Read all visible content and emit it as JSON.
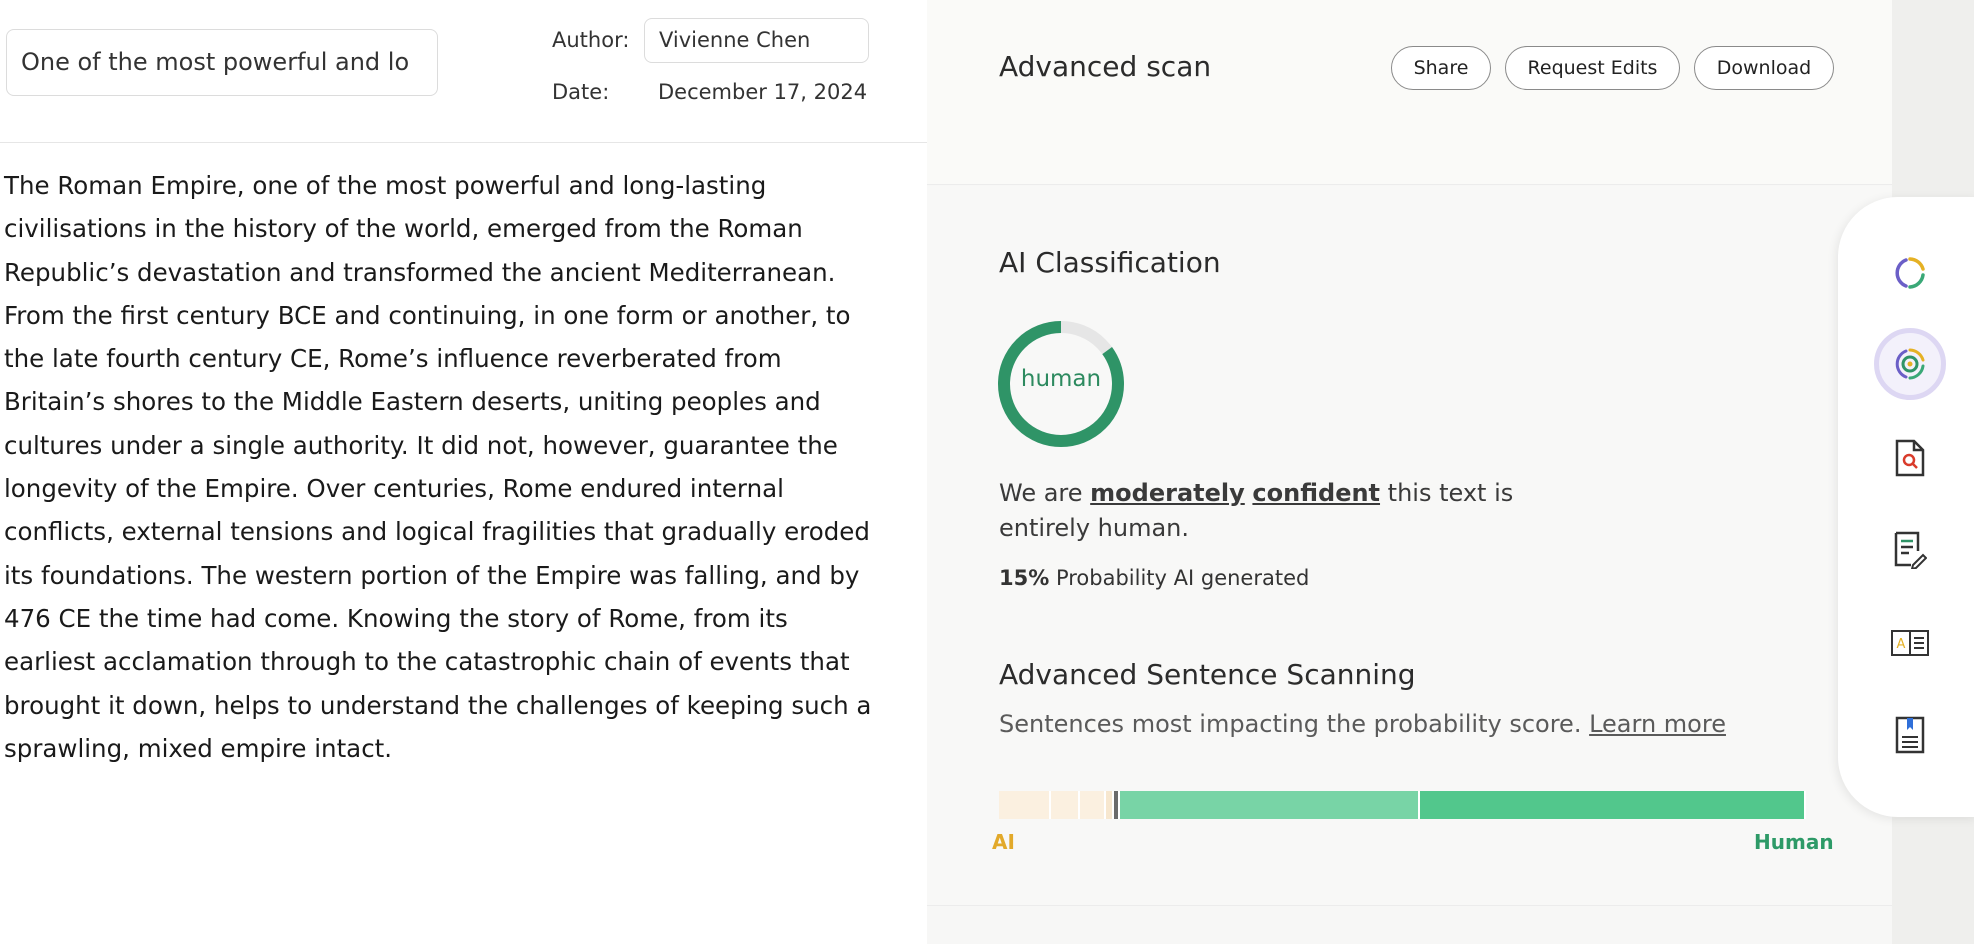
{
  "document": {
    "title": "One of the most powerful and lo",
    "author_label": "Author:",
    "author": "Vivienne Chen",
    "date_label": "Date:",
    "date": "December 17, 2024",
    "body": "The Roman Empire, one of the most powerful and long-lasting civilisations in the history of the world, emerged from the Roman Republic’s devastation and transformed the ancient Mediterranean. From the first century BCE and continuing, in one form or another, to the late fourth century CE, Rome’s influence reverberated from Britain’s shores to the Middle Eastern deserts, uniting peoples and cultures under a single authority. It did not, however, guarantee the longevity of the Empire. Over centuries, Rome endured internal conflicts, external tensions and logical fragilities that gradually eroded its foundations. The western portion of the Empire was falling, and by 476 CE the time had come. Knowing the story of Rome, from its earliest acclamation through to the catastrophic chain of events that brought it down, helps to understand the challenges of keeping such a sprawling, mixed empire intact."
  },
  "scan": {
    "title": "Advanced scan",
    "buttons": {
      "share": "Share",
      "request_edits": "Request Edits",
      "download": "Download"
    },
    "classification": {
      "title": "AI Classification",
      "result": "human",
      "human_fraction": 0.85,
      "colors": {
        "human": "#2f9467",
        "ai": "#e6e6e6"
      },
      "confidence_prefix": "We are",
      "confidence_word_1": "moderately",
      "confidence_word_2": "confident",
      "confidence_suffix": "this text is entirely human.",
      "probability_value": "15%",
      "probability_label": "Probability AI generated"
    },
    "sentence_scanning": {
      "title": "Advanced Sentence Scanning",
      "subtitle": "Sentences most impacting the probability score.",
      "learn_more": "Learn more",
      "ai_label": "AI",
      "human_label": "Human",
      "segments": [
        {
          "fraction": 0.065,
          "color": "#fbf0e0"
        },
        {
          "fraction": 0.035,
          "color": "#fbf0e0"
        },
        {
          "fraction": 0.033,
          "color": "#fbf0e0"
        },
        {
          "fraction": 0.01,
          "color": "#f7e7cf"
        },
        {
          "fraction": 0.007,
          "color": "#6b6b6b"
        },
        {
          "fraction": 0.372,
          "color": "#78d4a6"
        },
        {
          "fraction": 0.478,
          "color": "#52c78c"
        }
      ]
    }
  },
  "rail": {
    "items": [
      {
        "icon": "ring-icon"
      },
      {
        "icon": "target-scan-icon"
      },
      {
        "icon": "file-search-icon"
      },
      {
        "icon": "document-edit-icon"
      },
      {
        "icon": "text-compare-icon"
      },
      {
        "icon": "bookmark-document-icon"
      }
    ]
  }
}
